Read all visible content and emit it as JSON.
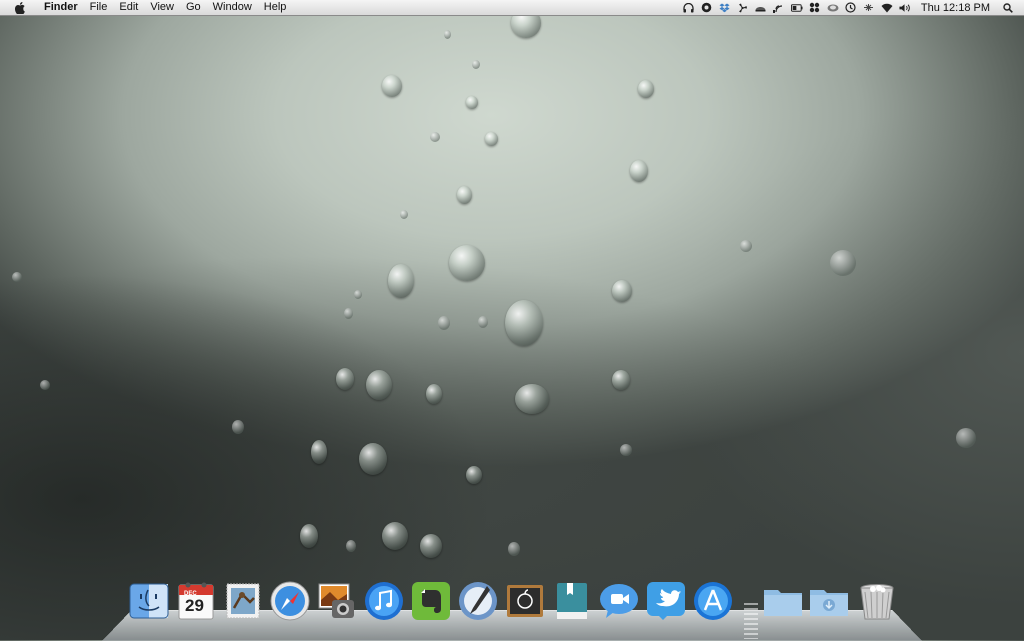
{
  "menubar": {
    "apple_icon": "apple-logo-icon",
    "app_name": "Finder",
    "menus": [
      "File",
      "Edit",
      "View",
      "Go",
      "Window",
      "Help"
    ],
    "status_icons": [
      "headphones-icon",
      "sync-icon",
      "dropbox-icon",
      "fan-icon",
      "eye-icon",
      "signal-icon",
      "battery-icon",
      "network-icon",
      "cloud-icon",
      "time-machine-icon",
      "bluetooth-icon",
      "wifi-icon",
      "volume-icon"
    ],
    "clock": "Thu 12:18 PM",
    "spotlight_icon": "spotlight-search-icon"
  },
  "dock": {
    "calendar": {
      "month": "DEC",
      "day": "29"
    },
    "items": [
      "Finder",
      "iCal",
      "Mail",
      "Safari",
      "iPhoto",
      "iTunes",
      "Evernote",
      "Text Edit",
      "Chalkboard",
      "Dictionary",
      "FaceTime",
      "Twitter",
      "App Store",
      "Applications",
      "Downloads",
      "Trash"
    ]
  },
  "colors": {
    "menubar_bg": "#e6e6e6",
    "wallpaper_mid": "#bcc6bd"
  }
}
